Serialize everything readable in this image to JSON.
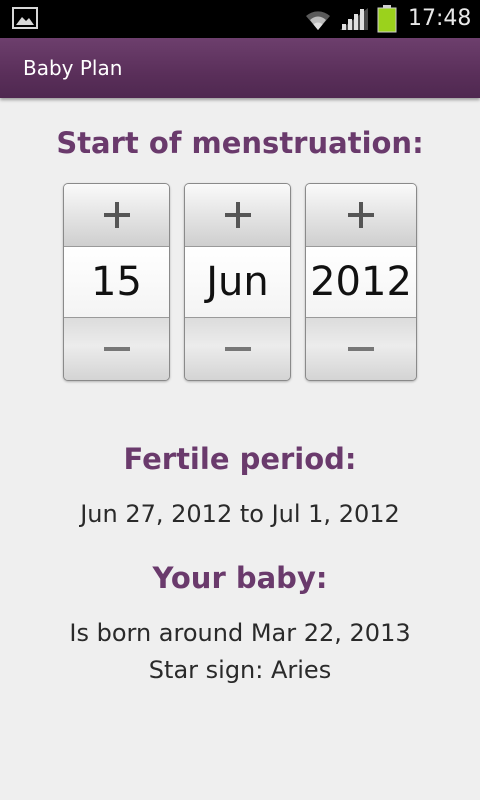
{
  "status_bar": {
    "time": "17:48",
    "icons": [
      "gallery-notification-icon",
      "wifi-icon",
      "signal-icon",
      "battery-icon"
    ],
    "battery_color": "#9bd21c"
  },
  "action_bar": {
    "title": "Baby Plan",
    "color": "#5a2f5a"
  },
  "menstruation": {
    "heading": "Start of menstruation:",
    "day": "15",
    "month": "Jun",
    "year": "2012"
  },
  "fertile": {
    "heading": "Fertile period:",
    "range": "Jun 27, 2012 to Jul 1, 2012"
  },
  "baby": {
    "heading": "Your baby:",
    "born": "Is born around Mar 22, 2013",
    "sign": "Star sign: Aries"
  },
  "accent_color": "#6a3a6c"
}
